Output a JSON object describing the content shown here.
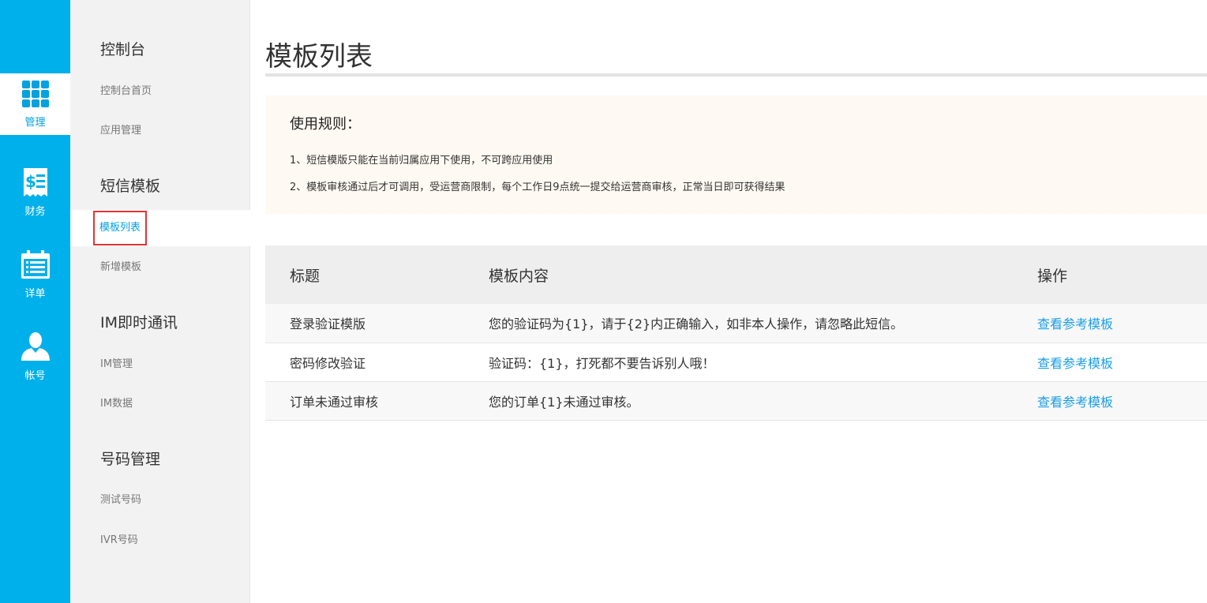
{
  "rail": {
    "items": [
      {
        "label": "管理",
        "icon": "grid-icon",
        "active": true
      },
      {
        "label": "财务",
        "icon": "invoice-icon",
        "active": false
      },
      {
        "label": "详单",
        "icon": "calendar-list-icon",
        "active": false
      },
      {
        "label": "帐号",
        "icon": "user-icon",
        "active": false
      }
    ],
    "color": "#00b0ea"
  },
  "sidebar": {
    "groups": [
      {
        "title": "控制台",
        "links": [
          "控制台首页",
          "应用管理"
        ]
      },
      {
        "title": "短信模板",
        "links": [
          "模板列表",
          "新增模板"
        ]
      },
      {
        "title": "IM即时通讯",
        "links": [
          "IM管理",
          "IM数据"
        ]
      },
      {
        "title": "号码管理",
        "links": [
          "测试号码",
          "IVR号码"
        ]
      }
    ],
    "active_link": "模板列表",
    "active_color": "#00a0e0"
  },
  "main": {
    "title": "模板列表",
    "notice": {
      "title": "使用规则：",
      "lines": [
        "1、短信模版只能在当前归属应用下使用，不可跨应用使用",
        "2、模板审核通过后才可调用，受运营商限制，每个工作日9点统一提交给运营商审核，正常当日即可获得结果"
      ]
    },
    "table": {
      "headers": [
        "标题",
        "模板内容",
        "操作"
      ],
      "rows": [
        {
          "title": "登录验证模版",
          "content": "您的验证码为{1}，请于{2}内正确输入，如非本人操作，请忽略此短信。",
          "action": "查看参考模板"
        },
        {
          "title": "密码修改验证",
          "content": "验证码：{1}，打死都不要告诉别人哦！",
          "action": "查看参考模板"
        },
        {
          "title": "订单未通过审核",
          "content": "您的订单{1}未通过审核。",
          "action": "查看参考模板"
        }
      ],
      "link_color": "#1a9ee8"
    }
  }
}
